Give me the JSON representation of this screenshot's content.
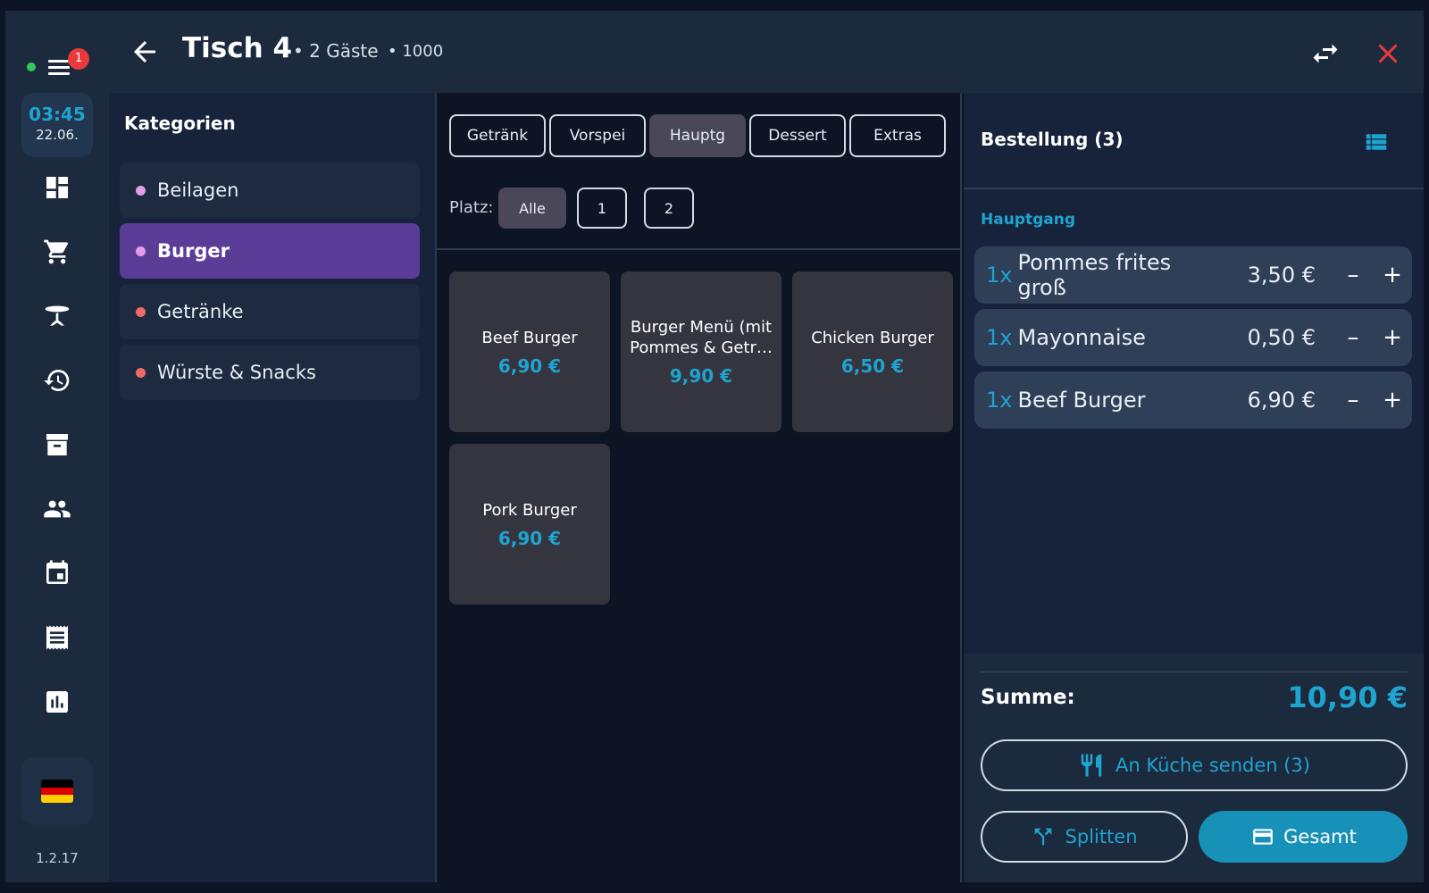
{
  "sidebar": {
    "notification_count": "1",
    "clock": {
      "time": "03:45",
      "date": "22.06."
    },
    "nav_icons": [
      "dashboard-icon",
      "cart-icon",
      "table-icon",
      "history-icon",
      "archive-icon",
      "people-icon",
      "calendar-icon",
      "receipt-icon",
      "chart-icon"
    ],
    "flag_colors": [
      "#000000",
      "#dd0000",
      "#ffce00"
    ],
    "version": "1.2.17"
  },
  "header": {
    "title": "Tisch 4",
    "guests": "• 2 Gäste",
    "code": "• 1000"
  },
  "categories": {
    "heading": "Kategorien",
    "items": [
      {
        "label": "Beilagen",
        "dot_color": "#e39ee8"
      },
      {
        "label": "Burger",
        "dot_color": "#e39ee8",
        "active": true
      },
      {
        "label": "Getränke",
        "dot_color": "#ee6a6a"
      },
      {
        "label": "Würste & Snacks",
        "dot_color": "#ee6a6a"
      }
    ]
  },
  "courses": {
    "tabs": [
      "Getränk",
      "Vorspei",
      "Hauptg",
      "Dessert",
      "Extras"
    ],
    "active": "Hauptg"
  },
  "seats": {
    "label": "Platz:",
    "options": [
      "Alle",
      "1",
      "2"
    ],
    "active": "Alle"
  },
  "products": [
    {
      "name": "Beef Burger",
      "price": "6,90 €"
    },
    {
      "name": "Burger Menü (mit Pommes & Getr…",
      "price": "9,90 €"
    },
    {
      "name": "Chicken Burger",
      "price": "6,50 €"
    },
    {
      "name": "Pork Burger",
      "price": "6,90 €"
    }
  ],
  "order": {
    "title": "Bestellung (3)",
    "course_label": "Hauptgang",
    "items": [
      {
        "qty": "1x",
        "name": "Pommes frites groß",
        "price": "3,50 €",
        "minus": "–",
        "plus": "+"
      },
      {
        "qty": "1x",
        "name": "Mayonnaise",
        "price": "0,50 €",
        "minus": "–",
        "plus": "+"
      },
      {
        "qty": "1x",
        "name": "Beef Burger",
        "price": "6,90 €",
        "minus": "–",
        "plus": "+"
      }
    ],
    "sum_label": "Summe:",
    "sum_value": "10,90 €",
    "kitchen_button": "An Küche senden (3)",
    "split_button": "Splitten",
    "pay_button": "Gesamt"
  },
  "colors": {
    "accent": "#1fa3cf",
    "active_category": "#5b3d98",
    "close": "#e83a3a",
    "status_online": "#34c759"
  }
}
